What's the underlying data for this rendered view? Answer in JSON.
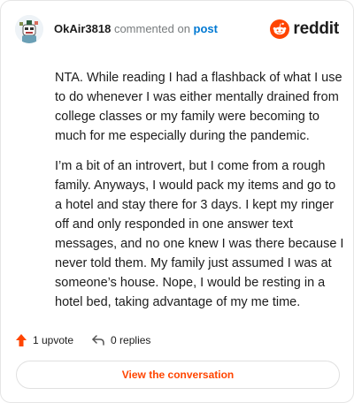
{
  "header": {
    "username": "OkAir3818",
    "action_text": " commented on ",
    "post_link": "post",
    "brand": "reddit"
  },
  "comment": {
    "paragraphs": [
      "NTA. While reading I had a flashback of what I use to do whenever I was either mentally drained from college classes or my family were becoming to much for me especially during the pandemic.",
      "I’m a bit of an introvert, but I come from a rough family. Anyways, I would pack my items and go to a hotel and stay there for 3 days. I kept my ringer off and only responded in one answer text messages, and no one knew I was there because I never told them. My family just assumed I was at someone’s house. Nope, I would be resting in a hotel bed, taking advantage of my me time."
    ]
  },
  "actions": {
    "upvotes": "1 upvote",
    "replies": "0 replies"
  },
  "cta": {
    "label": "View the conversation"
  },
  "icons": {
    "avatar": "avatar",
    "logo": "reddit-logo-icon",
    "upvote": "upvote-arrow-icon",
    "reply": "reply-arrow-icon"
  },
  "colors": {
    "accent": "#ff4500",
    "link": "#0079d3",
    "muted": "#787c7e"
  }
}
